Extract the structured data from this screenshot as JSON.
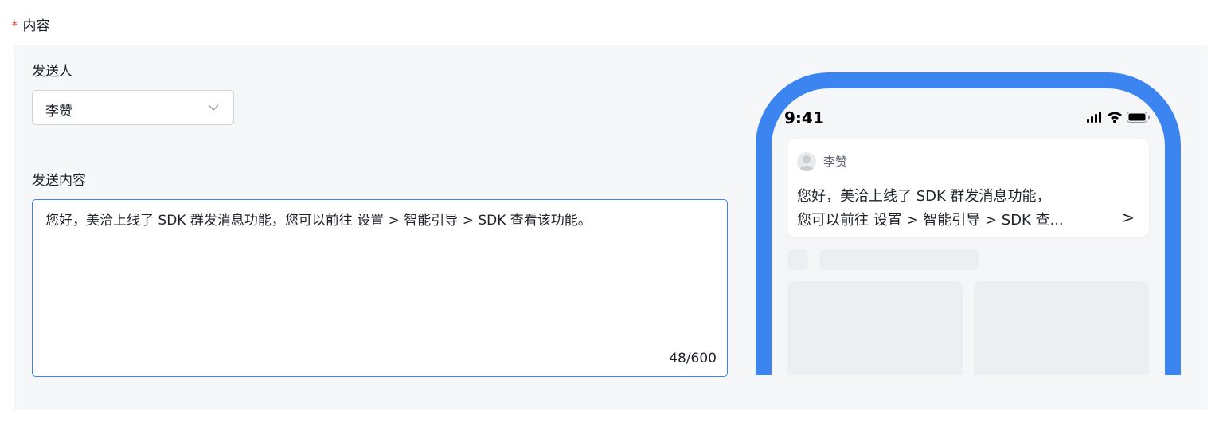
{
  "form": {
    "required_mark": "*",
    "section_label": "内容",
    "sender_label": "发送人",
    "sender_value": "李赞",
    "content_label": "发送内容",
    "content_value": "您好，美洽上线了 SDK 群发消息功能，您可以前往 设置 > 智能引导 > SDK 查看该功能。",
    "char_count": "48/600"
  },
  "preview": {
    "time": "9:41",
    "notification": {
      "sender": "李赞",
      "line1": "您好，美洽上线了 SDK 群发消息功能，",
      "line2": "您可以前往 设置 > 智能引导 > SDK 查...",
      "arrow": ">"
    }
  },
  "icons": {
    "dropdown": "chevron-down-icon",
    "signal": "signal-icon",
    "wifi": "wifi-icon",
    "battery": "battery-icon",
    "avatar": "avatar-icon"
  },
  "colors": {
    "required": "#f54a45",
    "phone_frame": "#3c84f0",
    "focus_border": "#3c7ff0",
    "panel_bg": "#f6f7f9"
  }
}
